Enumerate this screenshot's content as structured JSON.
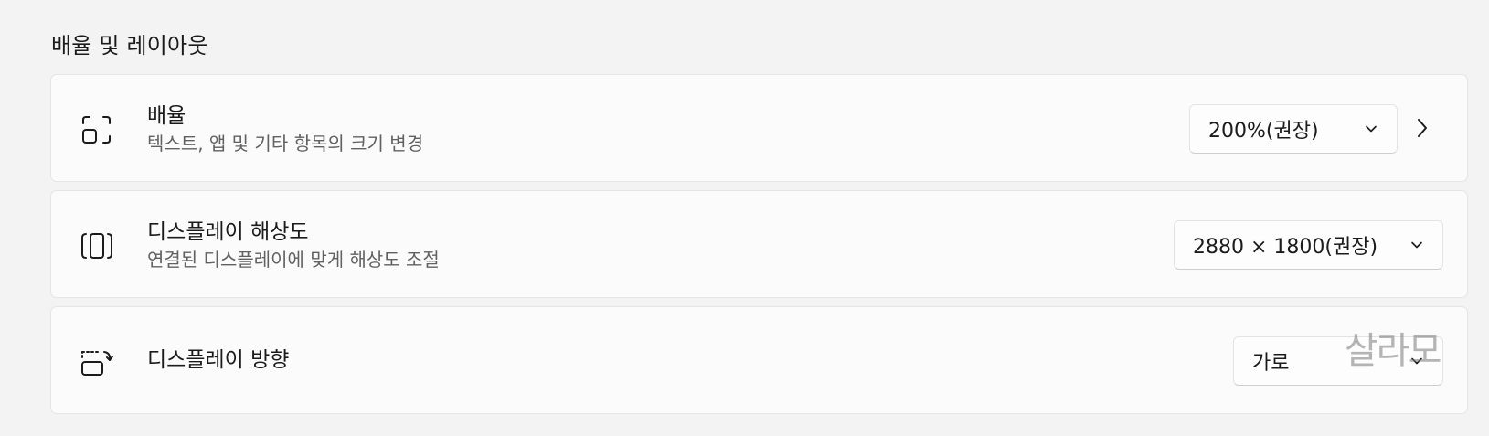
{
  "section": {
    "title": "배율 및 레이아웃"
  },
  "scale": {
    "title": "배율",
    "subtitle": "텍스트, 앱 및 기타 항목의 크기 변경",
    "value": "200%(권장)",
    "icon": "scale-icon"
  },
  "resolution": {
    "title": "디스플레이 해상도",
    "subtitle": " 연결된 디스플레이에 맞게 해상도 조절",
    "value": "2880 × 1800(권장)",
    "icon": "resolution-icon"
  },
  "orientation": {
    "title": "디스플레이 방향",
    "value": "가로",
    "icon": "orientation-icon"
  },
  "watermark": "살라모",
  "colors": {
    "background": "#f3f3f3",
    "card": "#fbfbfb",
    "secondary_text": "#616161"
  }
}
